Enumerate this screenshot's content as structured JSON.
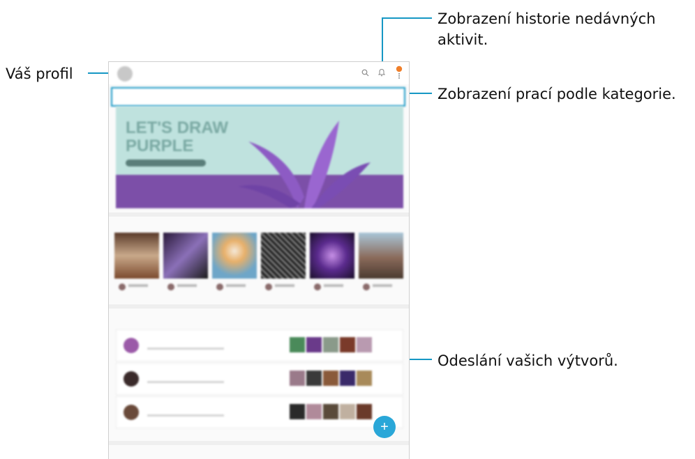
{
  "callouts": {
    "profile": "Váš profil",
    "history_line1": "Zobrazení historie nedávných",
    "history_line2": "aktivit.",
    "categories": "Zobrazení prací podle kategorie.",
    "upload": "Odeslání vašich výtvorů."
  },
  "app": {
    "username": "",
    "notification_count": "",
    "tabs": [
      {
        "label": "",
        "active": false
      },
      {
        "label": "",
        "active": true
      },
      {
        "label": "",
        "active": false
      },
      {
        "label": "",
        "active": false
      },
      {
        "label": "",
        "active": false
      }
    ],
    "banner": {
      "title": "LET'S DRAW PURPLE"
    },
    "sections": {
      "popular_artworks": "",
      "popular_artists": "",
      "view_all": ""
    },
    "artists": [
      {
        "name": ""
      },
      {
        "name": ""
      },
      {
        "name": ""
      }
    ],
    "fab": "+"
  },
  "colors": {
    "accent": "#1597c4",
    "banner_bg": "#bfe2de",
    "banner_purple": "#7c4fa8",
    "fab": "#2aa7d8"
  }
}
